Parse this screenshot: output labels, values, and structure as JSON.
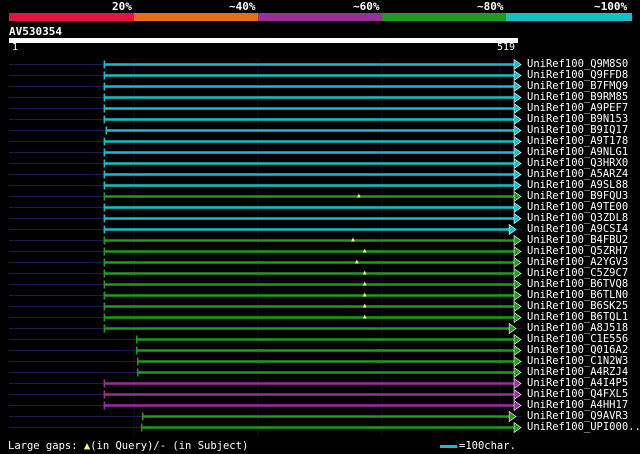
{
  "scale": {
    "labels": [
      "20%",
      "~40%",
      "~60%",
      "~80%",
      "~100%"
    ],
    "bands": [
      {
        "label": "20%",
        "color": "#e8123c"
      },
      {
        "label": "~40%",
        "color": "#e46f18"
      },
      {
        "label": "~60%",
        "color": "#9a2f9a"
      },
      {
        "label": "~80%",
        "color": "#1f9c1f"
      },
      {
        "label": "~100%",
        "color": "#17c0c8"
      }
    ]
  },
  "query": {
    "name": "AV530354",
    "start": "1",
    "end": "519",
    "length": 519
  },
  "colors": {
    "cyan": "#17c0c8",
    "green": "#1f9c1f",
    "purple": "#9a2f9a",
    "track": "#1c1c50",
    "gap": "#ffff66"
  },
  "hits": [
    {
      "label": "UniRef100_Q9M8S0",
      "color": "cyan",
      "start": 98,
      "end": 519,
      "gaps": []
    },
    {
      "label": "UniRef100_Q9FFD8",
      "color": "cyan",
      "start": 98,
      "end": 519,
      "gaps": []
    },
    {
      "label": "UniRef100_B7FMQ9",
      "color": "cyan",
      "start": 98,
      "end": 519,
      "gaps": []
    },
    {
      "label": "UniRef100_B9RM85",
      "color": "cyan",
      "start": 98,
      "end": 519,
      "gaps": []
    },
    {
      "label": "UniRef100_A9PEF7",
      "color": "cyan",
      "start": 98,
      "end": 519,
      "gaps": []
    },
    {
      "label": "UniRef100_B9N153",
      "color": "cyan",
      "start": 98,
      "end": 519,
      "gaps": []
    },
    {
      "label": "UniRef100_B9IQ17",
      "color": "cyan",
      "start": 100,
      "end": 519,
      "gaps": []
    },
    {
      "label": "UniRef100_A9T178",
      "color": "cyan",
      "start": 98,
      "end": 519,
      "gaps": []
    },
    {
      "label": "UniRef100_A9NLG1",
      "color": "cyan",
      "start": 98,
      "end": 519,
      "gaps": []
    },
    {
      "label": "UniRef100_Q3HRX0",
      "color": "cyan",
      "start": 98,
      "end": 519,
      "gaps": []
    },
    {
      "label": "UniRef100_A5ARZ4",
      "color": "cyan",
      "start": 98,
      "end": 519,
      "gaps": []
    },
    {
      "label": "UniRef100_A9SL88",
      "color": "cyan",
      "start": 98,
      "end": 519,
      "gaps": []
    },
    {
      "label": "UniRef100_B9FQU3",
      "color": "green",
      "start": 98,
      "end": 519,
      "gaps": [
        357
      ]
    },
    {
      "label": "UniRef100_A9TE00",
      "color": "cyan",
      "start": 98,
      "end": 519,
      "gaps": []
    },
    {
      "label": "UniRef100_Q3ZDL8",
      "color": "cyan",
      "start": 98,
      "end": 519,
      "gaps": []
    },
    {
      "label": "UniRef100_A9CSI4",
      "color": "cyan",
      "start": 98,
      "end": 514,
      "gaps": []
    },
    {
      "label": "UniRef100_B4FBU2",
      "color": "green",
      "start": 98,
      "end": 519,
      "gaps": [
        351
      ]
    },
    {
      "label": "UniRef100_Q5ZRH7",
      "color": "green",
      "start": 98,
      "end": 519,
      "gaps": [
        363
      ]
    },
    {
      "label": "UniRef100_A2YGV3",
      "color": "green",
      "start": 98,
      "end": 519,
      "gaps": [
        355
      ]
    },
    {
      "label": "UniRef100_C5Z9C7",
      "color": "green",
      "start": 98,
      "end": 519,
      "gaps": [
        363
      ]
    },
    {
      "label": "UniRef100_B6TVQ8",
      "color": "green",
      "start": 98,
      "end": 519,
      "gaps": [
        363
      ]
    },
    {
      "label": "UniRef100_B6TLN0",
      "color": "green",
      "start": 98,
      "end": 519,
      "gaps": [
        363
      ]
    },
    {
      "label": "UniRef100_B6SK25",
      "color": "green",
      "start": 98,
      "end": 519,
      "gaps": [
        363
      ]
    },
    {
      "label": "UniRef100_B6TQL1",
      "color": "green",
      "start": 98,
      "end": 519,
      "gaps": [
        363
      ]
    },
    {
      "label": "UniRef100_A8J518",
      "color": "green",
      "start": 98,
      "end": 514,
      "gaps": []
    },
    {
      "label": "UniRef100_C1E556",
      "color": "green",
      "start": 131,
      "end": 519,
      "gaps": []
    },
    {
      "label": "UniRef100_Q016A2",
      "color": "green",
      "start": 131,
      "end": 519,
      "gaps": []
    },
    {
      "label": "UniRef100_C1N2W3",
      "color": "green",
      "start": 132,
      "end": 519,
      "gaps": []
    },
    {
      "label": "UniRef100_A4RZJ4",
      "color": "green",
      "start": 132,
      "end": 519,
      "gaps": []
    },
    {
      "label": "UniRef100_A4I4P5",
      "color": "purple",
      "start": 98,
      "end": 519,
      "gaps": []
    },
    {
      "label": "UniRef100_Q4FXL5",
      "color": "purple",
      "start": 98,
      "end": 519,
      "gaps": []
    },
    {
      "label": "UniRef100_A4HH17",
      "color": "purple",
      "start": 98,
      "end": 519,
      "gaps": []
    },
    {
      "label": "UniRef100_Q9AVR3",
      "color": "green",
      "start": 137,
      "end": 514,
      "gaps": []
    },
    {
      "label": "UniRef100_UPI000..",
      "color": "green",
      "start": 136,
      "end": 519,
      "gaps": []
    }
  ],
  "footer": {
    "prefix": "Large gaps:",
    "tri": "▲",
    "mid": "(in Query)/",
    "dash": "-",
    "suffix": "(in Subject)"
  },
  "legend": {
    "label": "=100char."
  }
}
